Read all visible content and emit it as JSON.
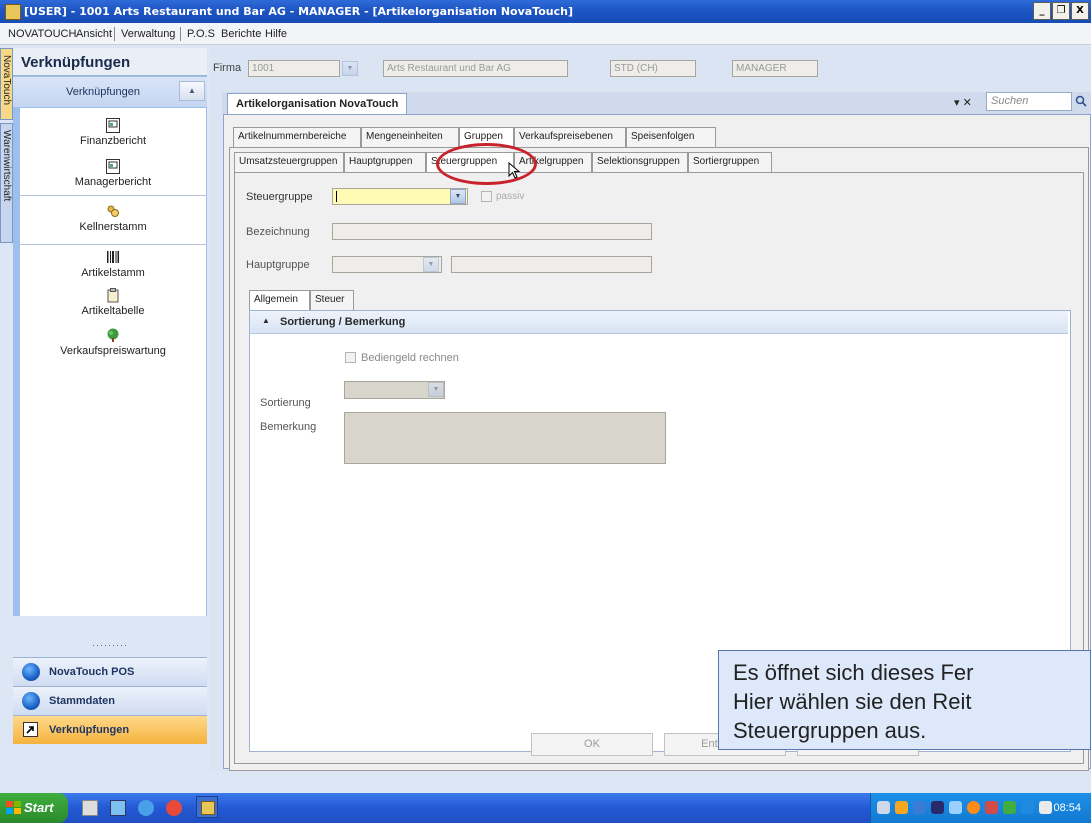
{
  "window": {
    "title": "[USER] - 1001 Arts Restaurant und Bar AG - MANAGER - [Artikelorganisation NovaTouch]",
    "controls": [
      "_",
      "❐",
      "X"
    ]
  },
  "menubar": {
    "items": [
      "NOVATOUCH",
      "Ansicht",
      "Verwaltung",
      "P.O.S",
      "Berichte",
      "Hilfe"
    ]
  },
  "side_tabs": [
    "NovaTouch",
    "Warenwirtschaft"
  ],
  "nav": {
    "header": "Verknüpfungen",
    "subheader": "Verknüpfungen",
    "items": [
      {
        "label": "Finanzbericht",
        "icon": "report-icon"
      },
      {
        "label": "Managerbericht",
        "icon": "report-icon"
      },
      {
        "label": "Kellnerstamm",
        "icon": "users-icon"
      },
      {
        "label": "Artikelstamm",
        "icon": "barcode-icon"
      },
      {
        "label": "Artikeltabelle",
        "icon": "clipboard-icon"
      },
      {
        "label": "Verkaufspreiswartung",
        "icon": "tree-icon"
      }
    ],
    "grip": "·········",
    "bottom_links": [
      "NovaTouch POS",
      "Stammdaten",
      "Verknüpfungen"
    ]
  },
  "context": {
    "firma_label": "Firma",
    "firma_value": "1001",
    "company": "Arts Restaurant und Bar AG",
    "currency": "STD (CH)",
    "role": "MANAGER"
  },
  "document": {
    "tab": "Artikelorganisation NovaTouch",
    "search_placeholder": "Suchen",
    "close_glyph": "▾ ✕"
  },
  "tabs_level1": [
    "Artikelnummernbereiche",
    "Mengeneinheiten",
    "Gruppen",
    "Verkaufspreisebenen",
    "Speisenfolgen"
  ],
  "tabs_level1_selected": "Gruppen",
  "tabs_level2": [
    "Umsatzsteuergruppen",
    "Hauptgruppen",
    "Steuergruppen",
    "Artikelgruppen",
    "Selektionsgruppen",
    "Sortiergruppen"
  ],
  "tabs_level2_selected": "Steuergruppen",
  "form": {
    "steuergruppe_label": "Steuergruppe",
    "passiv_label": "passiv",
    "bezeichnung_label": "Bezeichnung",
    "hauptgruppe_label": "Hauptgruppe"
  },
  "tabs_level3": [
    "Allgemein",
    "Steuer"
  ],
  "tabs_level3_selected": "Allgemein",
  "section": {
    "title": "Sortierung / Bemerkung",
    "bediengeld_label": "Bediengeld rechnen",
    "sortierung_label": "Sortierung",
    "bemerkung_label": "Bemerkung"
  },
  "buttons": {
    "ok": "OK",
    "entfernen": "Entfernen"
  },
  "callout": {
    "line1": "Es öffnet sich dieses Fer",
    "line2": "Hier wählen sie den Reit",
    "line3": "Steuergruppen aus."
  },
  "taskbar": {
    "start": "Start",
    "clock": "08:54"
  },
  "colors": {
    "titlebar": "#1d55c4",
    "highlight_ring": "#c8222a",
    "steuergruppe_field": "#fffbb5",
    "callout_bg": "#dde9fb"
  }
}
